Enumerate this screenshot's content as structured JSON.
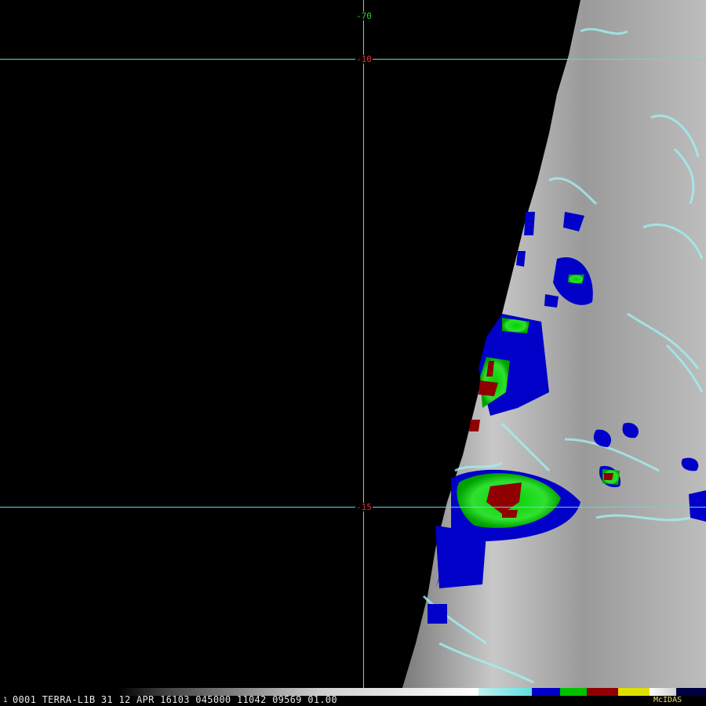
{
  "map": {
    "lat_labels": [
      "-10",
      "-15"
    ],
    "lon_labels": [
      "-70"
    ]
  },
  "status": {
    "frame": "1",
    "text": "0001 TERRA-L1B 31 12 APR 16103 045000 11042 09569 01.00",
    "brand": "McIDAS"
  },
  "colors": {
    "grid": "#5fd8e0",
    "lat_label": "#e03030",
    "lon_label": "#30d030",
    "brand": "#e8e060",
    "enhancement": [
      "#ffffff",
      "#a0f0f0",
      "#0000c8",
      "#00c000",
      "#900000",
      "#e0e000",
      "#000040"
    ]
  }
}
